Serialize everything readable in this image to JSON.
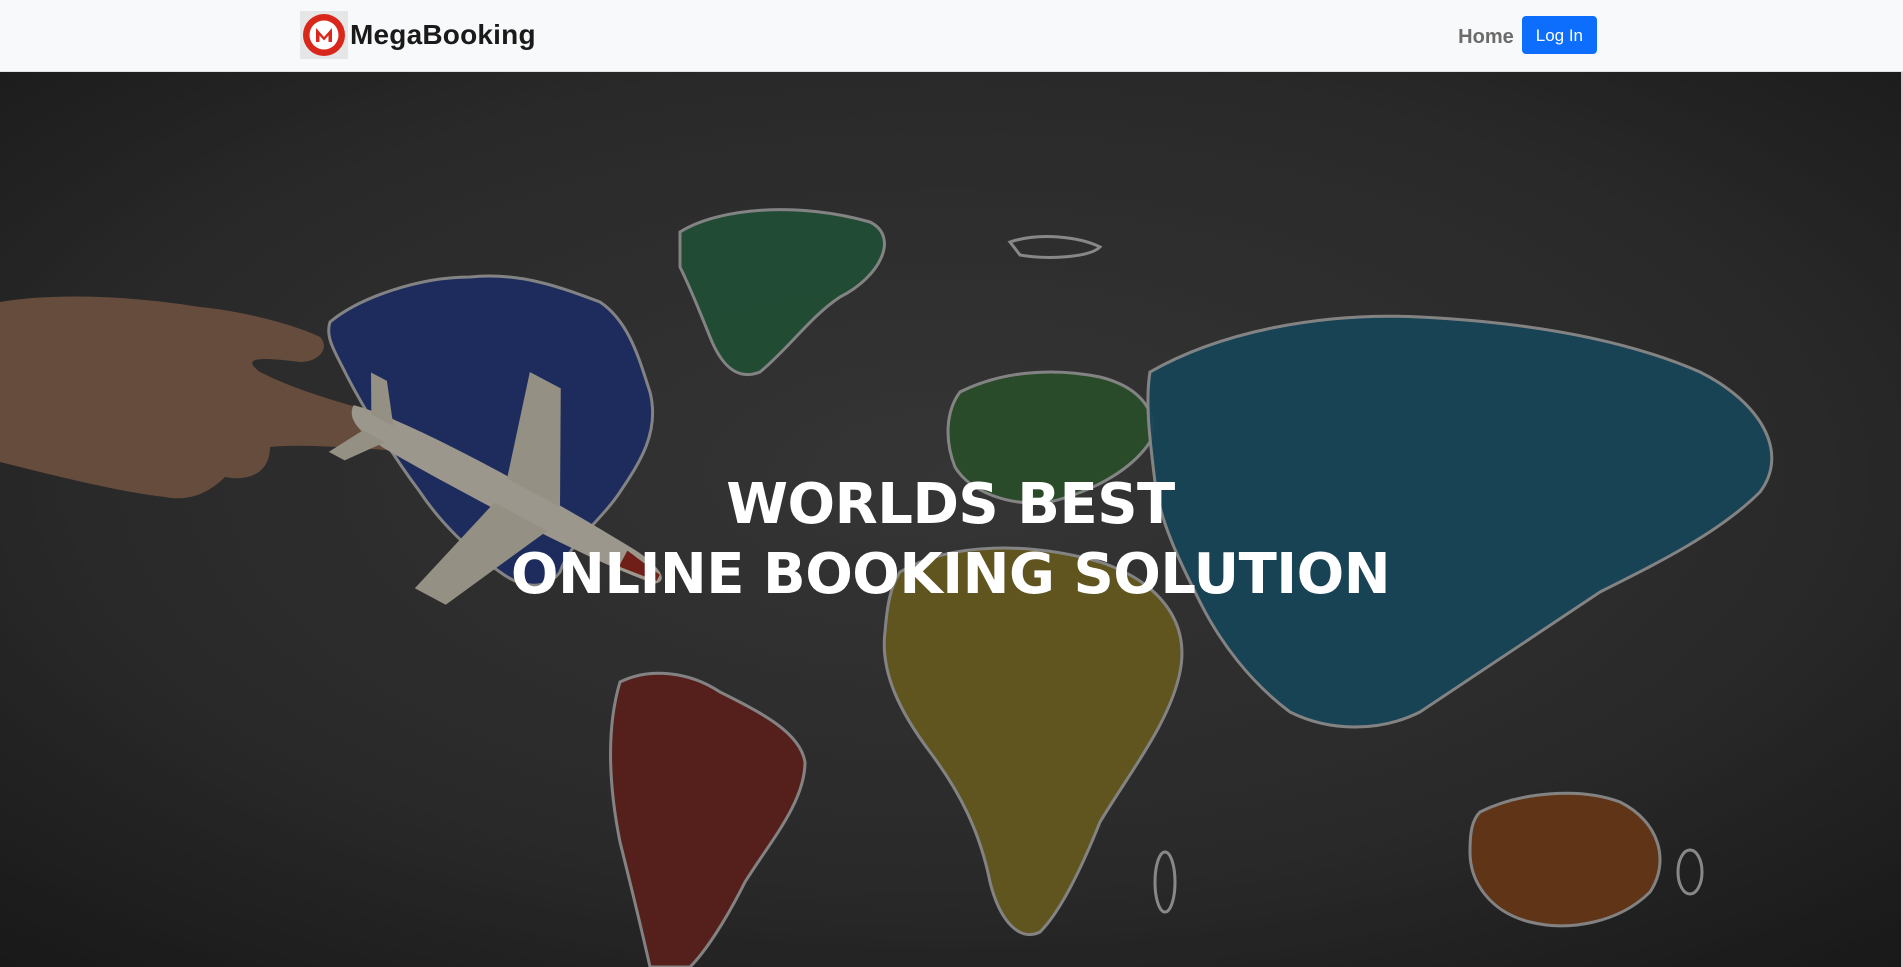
{
  "navbar": {
    "brand_name": "MegaBooking",
    "brand_logo_icon": "mega-m-logo-icon",
    "brand_color": "#d9271c",
    "home_label": "Home",
    "login_label": "Log In",
    "login_color": "#0d6efd"
  },
  "hero": {
    "heading_line1": "WORLDS BEST",
    "heading_line2": "ONLINE BOOKING SOLUTION",
    "background_icon": "world-map-chalkboard-image",
    "background_color": "#2f2f2f"
  }
}
